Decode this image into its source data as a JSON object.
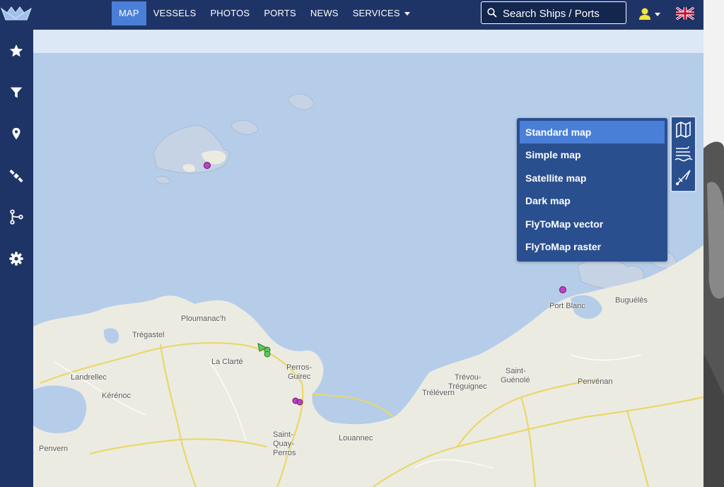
{
  "nav": {
    "items": [
      {
        "label": "MAP",
        "active": true
      },
      {
        "label": "VESSELS",
        "active": false
      },
      {
        "label": "PHOTOS",
        "active": false
      },
      {
        "label": "PORTS",
        "active": false
      },
      {
        "label": "NEWS",
        "active": false
      },
      {
        "label": "SERVICES",
        "active": false
      }
    ],
    "search_placeholder": "Search Ships / Ports"
  },
  "sidebar": {
    "icons": [
      "star-icon",
      "filter-icon",
      "map-pin-icon",
      "satellite-icon",
      "route-icon",
      "gear-icon"
    ]
  },
  "map": {
    "labels": {
      "ploumanach": "Ploumanac'h",
      "tregastel": "Trégastel",
      "la_clarte": "La Clarté",
      "perros_guirec_1": "Perros-",
      "perros_guirec_2": "Guirec",
      "landrellec": "Landrellec",
      "kerenoc": "Kérénoc",
      "penvern": "Penvern",
      "saint_quay_1": "Saint-",
      "saint_quay_2": "Quay-",
      "saint_quay_3": "Perros",
      "louannec": "Louannec",
      "trevou_1": "Trévou-",
      "trevou_2": "Tréguignec",
      "trelevern": "Trélévern",
      "saint_guenole_1": "Saint-",
      "saint_guenole_2": "Guénolé",
      "penvenan": "Penvénan",
      "port_blanc": "Port Blanc",
      "bugueles": "Buguélès"
    },
    "layer_menu": [
      {
        "label": "Standard map",
        "active": true
      },
      {
        "label": "Simple map",
        "active": false
      },
      {
        "label": "Satellite map",
        "active": false
      },
      {
        "label": "Dark map",
        "active": false
      },
      {
        "label": "FlyToMap vector",
        "active": false
      },
      {
        "label": "FlyToMap raster",
        "active": false
      }
    ],
    "tool_icons": [
      "map-layers-icon",
      "weather-wind-icon",
      "measure-compass-icon"
    ],
    "colors": {
      "sea": "#b5cde9",
      "land": "#ecebe2",
      "vessel_purple": "#c040c8",
      "vessel_green": "#5cc95c"
    }
  },
  "colors": {
    "navbar": "#1f3466",
    "accent": "#4a7fd7",
    "menu_bg": "#2a4f8f"
  }
}
